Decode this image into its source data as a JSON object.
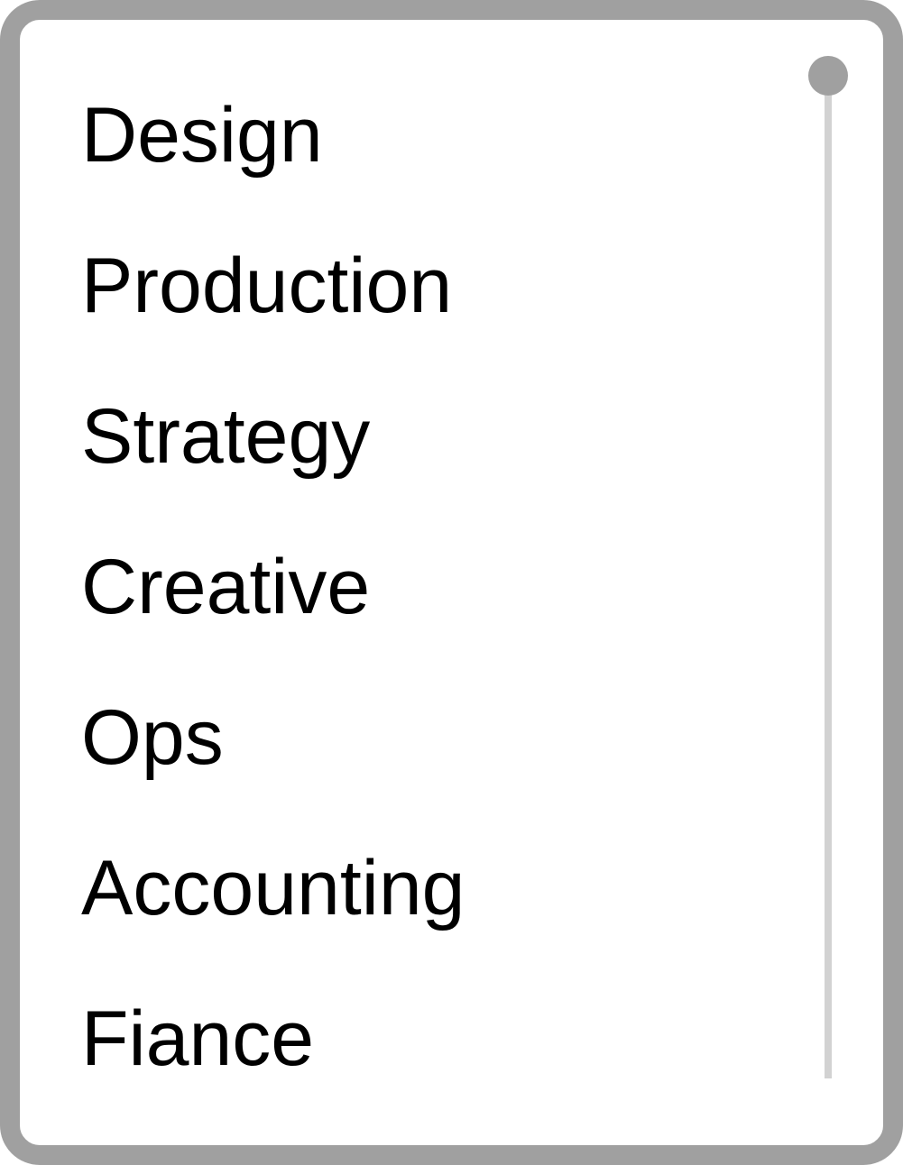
{
  "list": {
    "items": [
      {
        "label": "Design"
      },
      {
        "label": "Production"
      },
      {
        "label": "Strategy"
      },
      {
        "label": "Creative"
      },
      {
        "label": "Ops"
      },
      {
        "label": "Accounting"
      },
      {
        "label": "Fiance"
      }
    ]
  },
  "scrollbar": {
    "position": 0
  },
  "colors": {
    "border": "#a0a0a0",
    "track": "#d2d2d2",
    "thumb": "#a0a0a0",
    "text": "#000000",
    "background": "#ffffff"
  }
}
